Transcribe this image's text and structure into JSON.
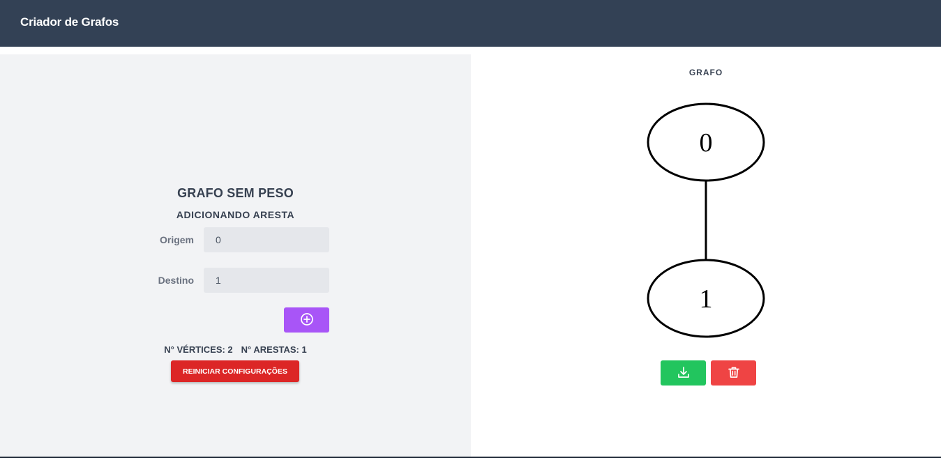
{
  "header": {
    "title": "Criador de Grafos"
  },
  "form": {
    "title": "GRAFO SEM PESO",
    "subtitle": "ADICIONANDO ARESTA",
    "origin_label": "Origem",
    "origin_value": "0",
    "destination_label": "Destino",
    "destination_value": "1",
    "add_icon": "plus-circle-icon",
    "vertices_label": "N° VÉRTICES: 2",
    "edges_label": "N° ARESTAS: 1",
    "reset_label": "REINICIAR CONFIGURAÇÕES"
  },
  "graph": {
    "heading": "GRAFO",
    "nodes": [
      "0",
      "1"
    ],
    "edges": [
      [
        "0",
        "1"
      ]
    ],
    "download_icon": "download-icon",
    "delete_icon": "trash-icon"
  },
  "colors": {
    "header_bg": "#334155",
    "add_button": "#a855f7",
    "reset_button": "#dc2626",
    "download_button": "#22c55e",
    "delete_button": "#ef4444"
  }
}
